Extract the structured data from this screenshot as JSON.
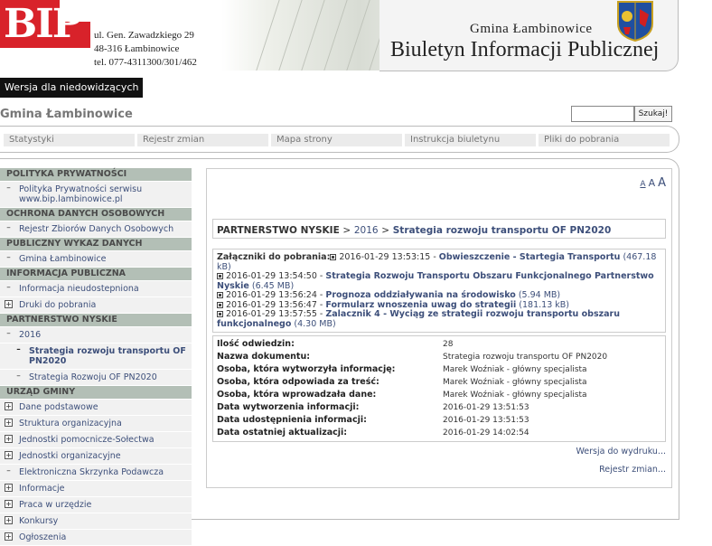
{
  "header": {
    "logo_text": "BIP",
    "address": [
      "ul. Gen. Zawadzkiego 29",
      "48-316 Łambinowice",
      "tel. 077-4311300/301/462"
    ],
    "gmina": "Gmina Łambinowice",
    "title": "Biuletyn Informacji Publicznej"
  },
  "access_button": "Wersja dla niedowidzących",
  "site_name": "Gmina Łambinowice",
  "search": {
    "value": "",
    "button": "Szukaj!"
  },
  "topnav": [
    "Statystyki",
    "Rejestr zmian",
    "Mapa strony",
    "Instrukcja biuletynu",
    "Pliki do pobrania"
  ],
  "sidebar": [
    {
      "type": "head",
      "label": "POLITYKA PRYWATNOŚCI"
    },
    {
      "type": "item",
      "marker": "–",
      "label": "Polityka Prywatności serwisu www.bip.lambinowice.pl"
    },
    {
      "type": "head",
      "label": "OCHRONA DANYCH OSOBOWYCH"
    },
    {
      "type": "item",
      "marker": "–",
      "label": "Rejestr Zbiorów Danych Osobowych"
    },
    {
      "type": "head",
      "label": "PUBLICZNY WYKAZ DANYCH"
    },
    {
      "type": "item",
      "marker": "–",
      "label": "Gmina Łambinowice"
    },
    {
      "type": "head",
      "label": "INFORMACJA PUBLICZNA"
    },
    {
      "type": "item",
      "marker": "–",
      "label": "Informacja nieudostepniona"
    },
    {
      "type": "item",
      "marker": "+",
      "label": "Druki do pobrania"
    },
    {
      "type": "head",
      "label": "PARTNERSTWO NYSKIE"
    },
    {
      "type": "item",
      "marker": "–",
      "label": "2016"
    },
    {
      "type": "sub",
      "marker": "–",
      "label": "Strategia rozwoju transportu OF PN2020",
      "active": true
    },
    {
      "type": "sub",
      "marker": "–",
      "label": "Strategia Rozwoju OF PN2020"
    },
    {
      "type": "head",
      "label": "URZĄD GMINY"
    },
    {
      "type": "item",
      "marker": "+",
      "label": "Dane podstawowe"
    },
    {
      "type": "item",
      "marker": "+",
      "label": "Struktura organizacyjna"
    },
    {
      "type": "item",
      "marker": "+",
      "label": "Jednostki pomocnicze-Sołectwa"
    },
    {
      "type": "item",
      "marker": "+",
      "label": "Jednostki organizacyjne"
    },
    {
      "type": "item",
      "marker": "–",
      "label": "Elektroniczna Skrzynka Podawcza"
    },
    {
      "type": "item",
      "marker": "+",
      "label": "Informacje"
    },
    {
      "type": "item",
      "marker": "+",
      "label": "Praca w urzędzie"
    },
    {
      "type": "item",
      "marker": "+",
      "label": "Konkursy"
    },
    {
      "type": "item",
      "marker": "+",
      "label": "Ogłoszenia"
    }
  ],
  "font_sizer": [
    "A",
    "A",
    "A"
  ],
  "breadcrumb": {
    "root": "PARTNERSTWO NYSKIE",
    "sep": ">",
    "year": "2016",
    "page": "Strategia rozwoju transportu OF PN2020"
  },
  "attachments": {
    "label": "Załączniki do pobrania:",
    "items": [
      {
        "date": "2016-01-29 13:53:15",
        "title": "Obwieszczenie - Startegia Transportu",
        "size": "(467.18 kB)"
      },
      {
        "date": "2016-01-29 13:54:50",
        "title": "Strategia Rozwoju Transportu Obszaru Funkcjonalnego Partnerstwo Nyskie",
        "size": "(6.45 MB)"
      },
      {
        "date": "2016-01-29 13:56:24",
        "title": "Prognoza oddziaływania na środowisko",
        "size": "(5.94 MB)"
      },
      {
        "date": "2016-01-29 13:56:47",
        "title": "Formularz wnoszenia uwag do strategii",
        "size": "(181.13 kB)"
      },
      {
        "date": "2016-01-29 13:57:55",
        "title": "Zalacznik 4 - Wyciąg ze strategii rozwoju transportu obszaru funkcjonalnego",
        "size": "(4.30 MB)"
      }
    ]
  },
  "meta": [
    {
      "label": "Ilość odwiedzin:",
      "value": "28"
    },
    {
      "label": "Nazwa dokumentu:",
      "value": "Strategia rozwoju transportu OF PN2020"
    },
    {
      "label": "Osoba, która wytworzyła informację:",
      "value": "Marek Woźniak - główny specjalista"
    },
    {
      "label": "Osoba, która odpowiada za treść:",
      "value": "Marek Woźniak - główny specjalista"
    },
    {
      "label": "Osoba, która wprowadzała dane:",
      "value": "Marek Woźniak - główny specjalista"
    },
    {
      "label": "Data wytworzenia informacji:",
      "value": "2016-01-29 13:51:53"
    },
    {
      "label": "Data udostępnienia informacji:",
      "value": "2016-01-29 13:51:53"
    },
    {
      "label": "Data ostatniej aktualizacji:",
      "value": "2016-01-29 14:02:54"
    }
  ],
  "print_link": "Wersja do wydruku...",
  "changes_link": "Rejestr zmian..."
}
